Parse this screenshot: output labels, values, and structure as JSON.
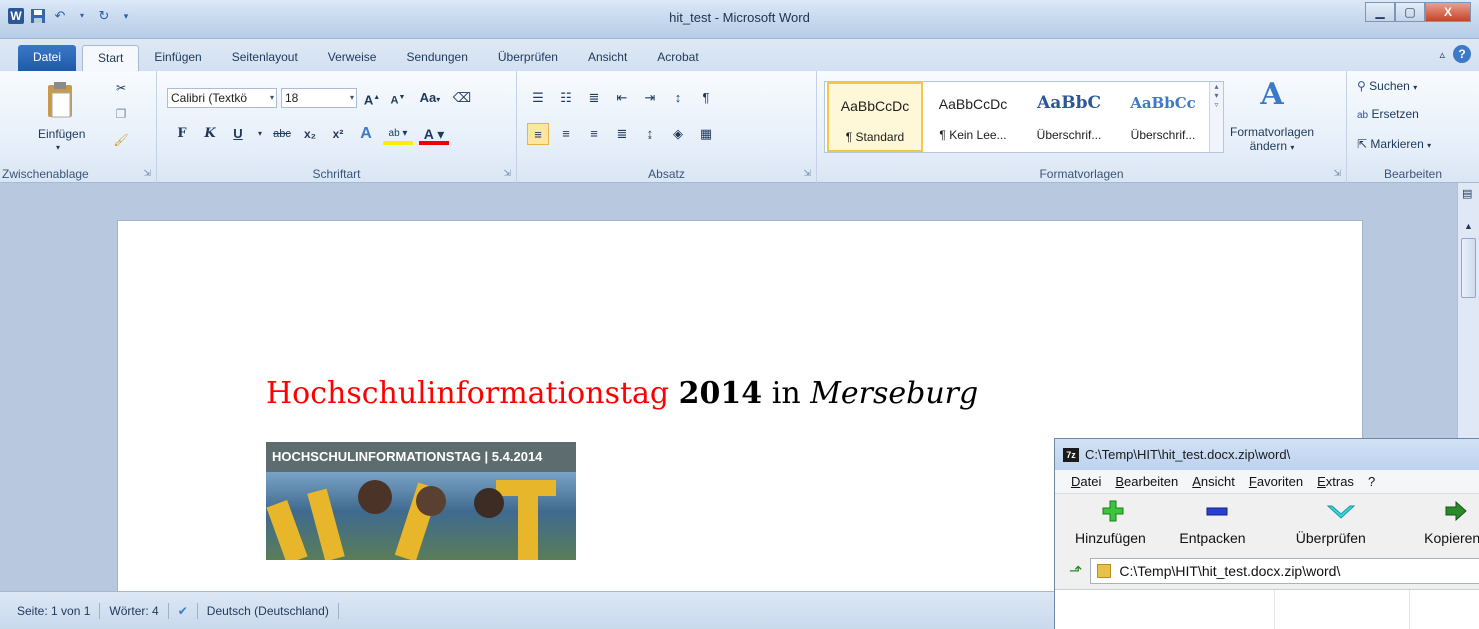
{
  "window": {
    "title": "hit_test - Microsoft Word",
    "controls": {
      "minimize": "▁",
      "maximize": "▢",
      "close": "X"
    }
  },
  "qat": {
    "word_icon": "W",
    "save_icon": "save-icon",
    "undo_icon": "undo-icon",
    "redo_icon": "redo-icon"
  },
  "tabs": [
    {
      "label": "Datei"
    },
    {
      "label": "Start"
    },
    {
      "label": "Einfügen"
    },
    {
      "label": "Seitenlayout"
    },
    {
      "label": "Verweise"
    },
    {
      "label": "Sendungen"
    },
    {
      "label": "Überprüfen"
    },
    {
      "label": "Ansicht"
    },
    {
      "label": "Acrobat"
    }
  ],
  "ribbon": {
    "clipboard": {
      "label": "Zwischenablage",
      "paste": "Einfügen"
    },
    "font": {
      "label": "Schriftart",
      "font_name": "Calibri (Textkö",
      "font_size": "18",
      "aa_label": "Aa",
      "bold": "F",
      "italic": "K",
      "underline": "U",
      "strike": "abc",
      "subscript": "x₂",
      "superscript": "x²"
    },
    "paragraph": {
      "label": "Absatz"
    },
    "styles": {
      "label": "Formatvorlagen",
      "items": [
        {
          "preview": "AaBbCcDc",
          "name": "¶ Standard"
        },
        {
          "preview": "AaBbCcDc",
          "name": "¶ Kein Lee..."
        },
        {
          "preview": "AaBbC",
          "name": "Überschrif..."
        },
        {
          "preview": "AaBbCc",
          "name": "Überschrif..."
        }
      ],
      "change_label_1": "Formatvorlagen",
      "change_label_2": "ändern"
    },
    "editing": {
      "label": "Bearbeiten",
      "find": "Suchen",
      "replace": "Ersetzen",
      "select": "Markieren"
    }
  },
  "document": {
    "heading": {
      "part1": "Hochschulinformationstag",
      "part2": "2014",
      "part3": "in",
      "part4": "Merseburg"
    },
    "banner_text": "HOCHSCHULINFORMATIONSTAG | 5.4.2014"
  },
  "status": {
    "page": "Seite: 1 von 1",
    "words": "Wörter: 4",
    "language": "Deutsch (Deutschland)"
  },
  "zip": {
    "title": "C:\\Temp\\HIT\\hit_test.docx.zip\\word\\",
    "menu": [
      "Datei",
      "Bearbeiten",
      "Ansicht",
      "Favoriten",
      "Extras",
      "?"
    ],
    "tools": [
      "Hinzufügen",
      "Entpacken",
      "Überprüfen",
      "Kopieren"
    ],
    "path": "C:\\Temp\\HIT\\hit_test.docx.zip\\word\\"
  }
}
